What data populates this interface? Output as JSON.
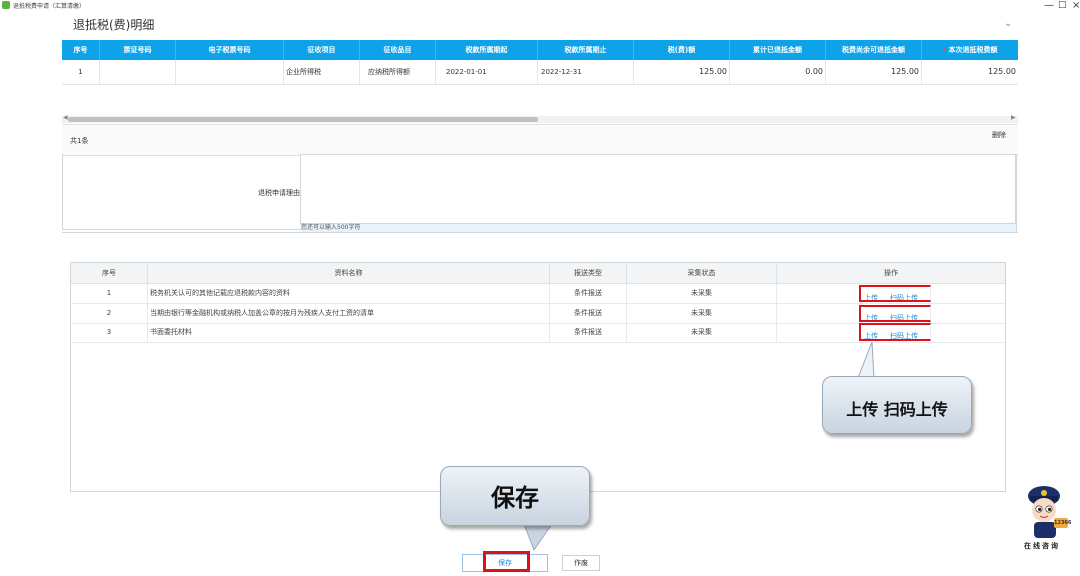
{
  "window": {
    "title": "退抵税费申请（汇算清缴）",
    "minimize": "—",
    "maximize": "□",
    "close": "×"
  },
  "section": {
    "title": "退抵税(费)明细",
    "collapse_icon": "chevron-down-icon"
  },
  "detail_table": {
    "headers": [
      "序号",
      "票证号码",
      "电子税票号码",
      "征收项目",
      "征收品目",
      "税款所属期起",
      "税款所属期止",
      "税(费)额",
      "累计已退抵金额",
      "税费尚余可退抵金额",
      "本次退抵税费额"
    ],
    "required_marker": "*",
    "rows": [
      {
        "seq": "1",
        "voucher_no": "",
        "e_tax_no": "",
        "item": "企业所得税",
        "sub_item": "应纳税所得额",
        "period_start": "2022-01-01",
        "period_end": "2022-12-31",
        "tax_amount": "125.00",
        "refunded": "0.00",
        "remaining": "125.00",
        "this_refund": "125.00"
      }
    ]
  },
  "count_text": "共1条",
  "delete_label": "删除",
  "reason": {
    "label": "退税申请理由",
    "value": "",
    "hint": "您还可以输入500字符"
  },
  "materials_table": {
    "headers": [
      "序号",
      "资料名称",
      "报送类型",
      "采集状态",
      "操作"
    ],
    "upload_label": "上传",
    "scan_label": "扫码上传",
    "rows": [
      {
        "seq": "1",
        "name": "税务机关认可的其他记载应退税款内容的资料",
        "type": "条件报送",
        "status": "未采集"
      },
      {
        "seq": "2",
        "name": "当期由银行等金融机构或纳税人加盖公章的按月为残疾人支付工资的清单",
        "type": "条件报送",
        "status": "未采集"
      },
      {
        "seq": "3",
        "name": "书面委托材料",
        "type": "条件报送",
        "status": "未采集"
      }
    ]
  },
  "callouts": {
    "upload": "上传  扫码上传",
    "save": "保存"
  },
  "buttons": {
    "save": "保存",
    "void": "作废"
  },
  "mascot": {
    "label": "在线咨询",
    "badge": "12366"
  },
  "colors": {
    "header_blue": "#0ea3e8",
    "highlight_red": "#e0101a",
    "link_blue": "#1a8cd8"
  }
}
